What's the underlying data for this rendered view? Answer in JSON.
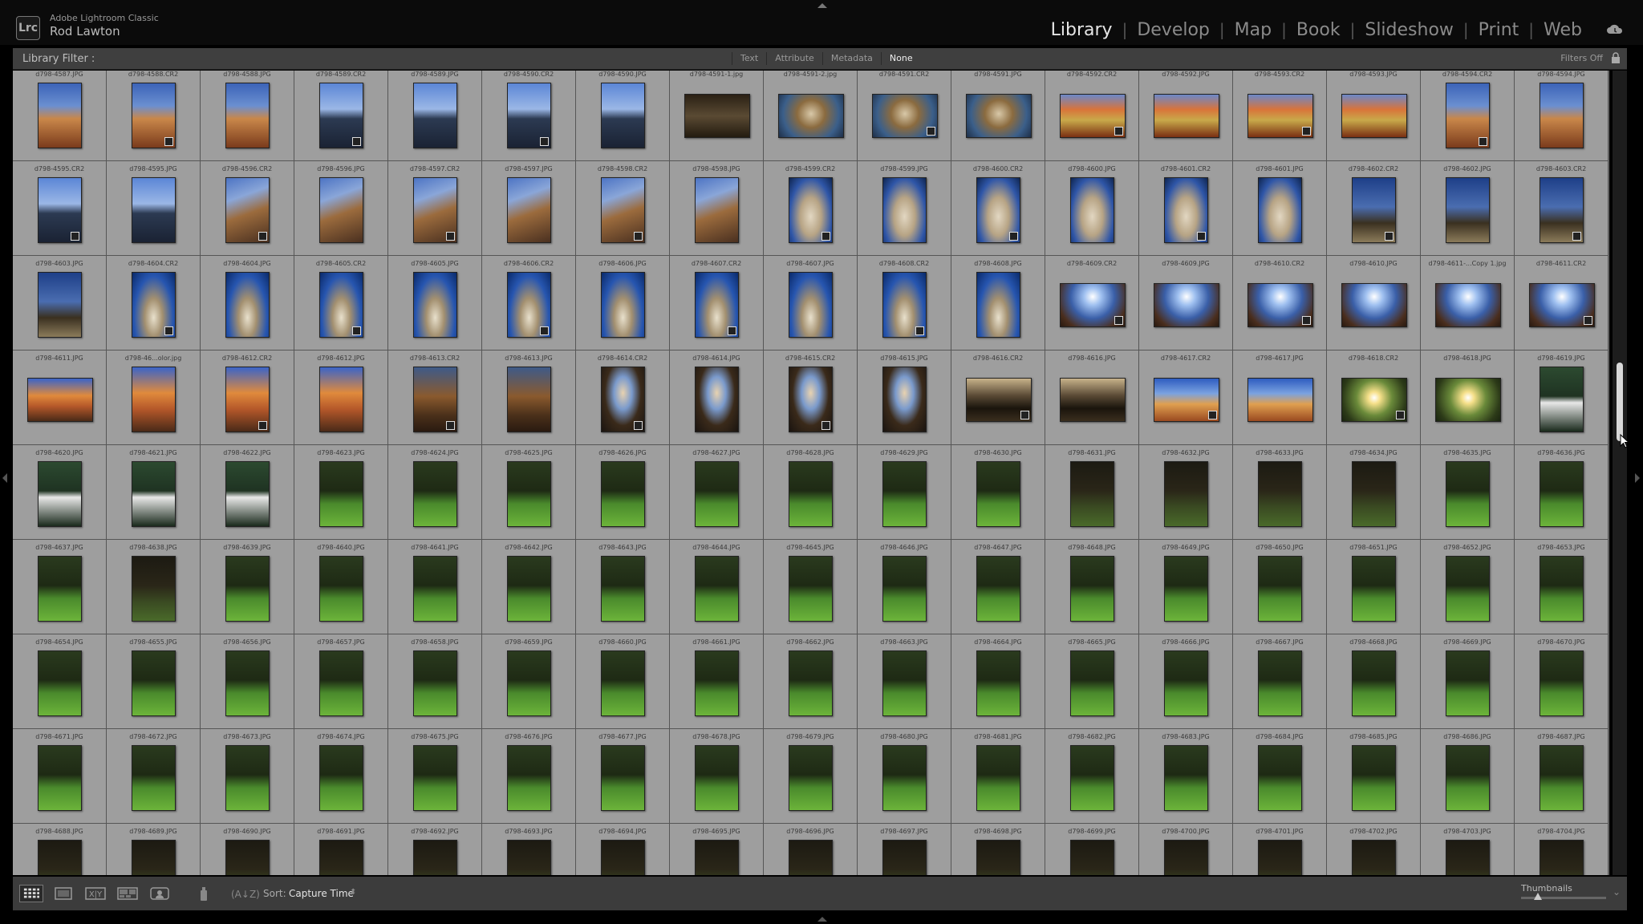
{
  "app": {
    "logo": "Lrc",
    "product": "Adobe Lightroom Classic",
    "identity": "Rod Lawton",
    "modules": [
      "Library",
      "Develop",
      "Map",
      "Book",
      "Slideshow",
      "Print",
      "Web"
    ],
    "active_module": "Library"
  },
  "filter_bar": {
    "label": "Library Filter :",
    "tabs": [
      "Text",
      "Attribute",
      "Metadata",
      "None"
    ],
    "active_tab": "None",
    "status": "Filters Off"
  },
  "toolbar": {
    "sort_label": "Sort:",
    "sort_value": "Capture Time",
    "thumbnails_label": "Thumbnails",
    "thumbnail_size": 0.15
  },
  "colors": {
    "grid_cell": "#9e9e9e",
    "panel": "#3f3f3f",
    "background": "#000000",
    "active_text": "#e6e6e6"
  },
  "grid": {
    "rows": [
      {
        "files": [
          "d798-4587.JPG",
          "d798-4588.CR2",
          "d798-4588.JPG",
          "d798-4589.CR2",
          "d798-4589.JPG",
          "d798-4590.CR2",
          "d798-4590.JPG",
          "d798-4591-1.jpg",
          "d798-4591-2.jpg",
          "d798-4591.CR2",
          "d798-4591.JPG",
          "d798-4592.CR2",
          "d798-4592.JPG",
          "d798-4593.CR2",
          "d798-4593.JPG",
          "d798-4594.CR2",
          "d798-4594.JPG"
        ],
        "orient": [
          "p",
          "p",
          "p",
          "p",
          "p",
          "p",
          "p",
          "l",
          "l",
          "l",
          "l",
          "l",
          "l",
          "l",
          "l",
          "p",
          "p"
        ],
        "scene": [
          "autumn",
          "autumn",
          "autumn",
          "pond",
          "pond",
          "pond",
          "pond",
          "dark",
          "fisheye",
          "fisheye",
          "fisheye",
          "leaves",
          "leaves",
          "leaves",
          "leaves",
          "autumn",
          "autumn"
        ]
      },
      {
        "files": [
          "d798-4595.CR2",
          "d798-4595.JPG",
          "d798-4596.CR2",
          "d798-4596.JPG",
          "d798-4597.CR2",
          "d798-4597.JPG",
          "d798-4598.CR2",
          "d798-4598.JPG",
          "d798-4599.CR2",
          "d798-4599.JPG",
          "d798-4600.CR2",
          "d798-4600.JPG",
          "d798-4601.CR2",
          "d798-4601.JPG",
          "d798-4602.CR2",
          "d798-4602.JPG",
          "d798-4603.CR2"
        ],
        "orient": [
          "p",
          "p",
          "p",
          "p",
          "p",
          "p",
          "p",
          "p",
          "p",
          "p",
          "p",
          "p",
          "p",
          "p",
          "p",
          "p",
          "p"
        ],
        "scene": [
          "pond",
          "pond",
          "branch",
          "branch",
          "branch",
          "branch",
          "branch",
          "branch",
          "trunk",
          "trunk",
          "trunk",
          "trunk",
          "trunk",
          "trunk",
          "tree",
          "tree",
          "tree"
        ]
      },
      {
        "files": [
          "d798-4603.JPG",
          "d798-4604.CR2",
          "d798-4604.JPG",
          "d798-4605.CR2",
          "d798-4605.JPG",
          "d798-4606.CR2",
          "d798-4606.JPG",
          "d798-4607.CR2",
          "d798-4607.JPG",
          "d798-4608.CR2",
          "d798-4608.JPG",
          "d798-4609.CR2",
          "d798-4609.JPG",
          "d798-4610.CR2",
          "d798-4610.JPG",
          "d798-4611-...Copy 1.jpg",
          "d798-4611.CR2"
        ],
        "orient": [
          "p",
          "p",
          "p",
          "p",
          "p",
          "p",
          "p",
          "p",
          "p",
          "p",
          "p",
          "l",
          "l",
          "l",
          "l",
          "l",
          "l"
        ],
        "scene": [
          "tree",
          "sky",
          "sky",
          "sky",
          "sky",
          "sky",
          "sky",
          "sky",
          "sky",
          "sky",
          "sky",
          "sun",
          "sun",
          "sun",
          "sun",
          "sun",
          "sun"
        ]
      },
      {
        "files": [
          "d798-4611.JPG",
          "d798-46...olor.jpg",
          "d798-4612.CR2",
          "d798-4612.JPG",
          "d798-4613.CR2",
          "d798-4613.JPG",
          "d798-4614.CR2",
          "d798-4614.JPG",
          "d798-4615.CR2",
          "d798-4615.JPG",
          "d798-4616.CR2",
          "d798-4616.JPG",
          "d798-4617.CR2",
          "d798-4617.JPG",
          "d798-4618.CR2",
          "d798-4618.JPG",
          "d798-4619.JPG"
        ],
        "orient": [
          "l",
          "p",
          "p",
          "p",
          "p",
          "p",
          "p",
          "p",
          "p",
          "p",
          "l",
          "l",
          "l",
          "l",
          "l",
          "l",
          "p"
        ],
        "scene": [
          "bigtree",
          "bigtree",
          "bigtree",
          "bigtree",
          "rusty",
          "rusty",
          "shadow",
          "shadow",
          "shadow",
          "shadow",
          "silhouette",
          "silhouette",
          "autumnsky",
          "autumnsky",
          "sunflare",
          "sunflare",
          "person"
        ]
      },
      {
        "files": [
          "d798-4620.JPG",
          "d798-4621.JPG",
          "d798-4622.JPG",
          "d798-4623.JPG",
          "d798-4624.JPG",
          "d798-4625.JPG",
          "d798-4626.JPG",
          "d798-4627.JPG",
          "d798-4628.JPG",
          "d798-4629.JPG",
          "d798-4630.JPG",
          "d798-4631.JPG",
          "d798-4632.JPG",
          "d798-4633.JPG",
          "d798-4634.JPG",
          "d798-4635.JPG",
          "d798-4636.JPG"
        ],
        "orient": [
          "p",
          "p",
          "p",
          "p",
          "p",
          "p",
          "p",
          "p",
          "p",
          "p",
          "p",
          "p",
          "p",
          "p",
          "p",
          "p",
          "p"
        ],
        "scene": [
          "person",
          "person",
          "person",
          "lawn",
          "lawn",
          "lawn",
          "lawn",
          "lawn",
          "lawn",
          "lawn",
          "lawn",
          "dim",
          "dim",
          "dim",
          "dim",
          "lawn",
          "lawn"
        ]
      },
      {
        "files": [
          "d798-4637.JPG",
          "d798-4638.JPG",
          "d798-4639.JPG",
          "d798-4640.JPG",
          "d798-4641.JPG",
          "d798-4642.JPG",
          "d798-4643.JPG",
          "d798-4644.JPG",
          "d798-4645.JPG",
          "d798-4646.JPG",
          "d798-4647.JPG",
          "d798-4648.JPG",
          "d798-4649.JPG",
          "d798-4650.JPG",
          "d798-4651.JPG",
          "d798-4652.JPG",
          "d798-4653.JPG"
        ],
        "orient": [
          "p",
          "p",
          "p",
          "p",
          "p",
          "p",
          "p",
          "p",
          "p",
          "p",
          "p",
          "p",
          "p",
          "p",
          "p",
          "p",
          "p"
        ],
        "scene": [
          "lawn",
          "dim",
          "lawn",
          "lawn",
          "lawn",
          "lawn",
          "lawn",
          "lawn",
          "lawn",
          "lawn",
          "lawn",
          "lawn",
          "lawn",
          "lawn",
          "lawn",
          "lawn",
          "lawn"
        ]
      },
      {
        "files": [
          "d798-4654.JPG",
          "d798-4655.JPG",
          "d798-4656.JPG",
          "d798-4657.JPG",
          "d798-4658.JPG",
          "d798-4659.JPG",
          "d798-4660.JPG",
          "d798-4661.JPG",
          "d798-4662.JPG",
          "d798-4663.JPG",
          "d798-4664.JPG",
          "d798-4665.JPG",
          "d798-4666.JPG",
          "d798-4667.JPG",
          "d798-4668.JPG",
          "d798-4669.JPG",
          "d798-4670.JPG"
        ],
        "orient": [
          "p",
          "p",
          "p",
          "p",
          "p",
          "p",
          "p",
          "p",
          "p",
          "p",
          "p",
          "p",
          "p",
          "p",
          "p",
          "p",
          "p"
        ],
        "scene": [
          "lawn",
          "lawn",
          "lawn",
          "lawn",
          "lawn",
          "lawn",
          "lawn",
          "lawn",
          "lawn",
          "lawn",
          "lawn",
          "lawn",
          "lawn",
          "lawn",
          "lawn",
          "lawn",
          "lawn"
        ]
      },
      {
        "files": [
          "d798-4671.JPG",
          "d798-4672.JPG",
          "d798-4673.JPG",
          "d798-4674.JPG",
          "d798-4675.JPG",
          "d798-4676.JPG",
          "d798-4677.JPG",
          "d798-4678.JPG",
          "d798-4679.JPG",
          "d798-4680.JPG",
          "d798-4681.JPG",
          "d798-4682.JPG",
          "d798-4683.JPG",
          "d798-4684.JPG",
          "d798-4685.JPG",
          "d798-4686.JPG",
          "d798-4687.JPG"
        ],
        "orient": [
          "p",
          "p",
          "p",
          "p",
          "p",
          "p",
          "p",
          "p",
          "p",
          "p",
          "p",
          "p",
          "p",
          "p",
          "p",
          "p",
          "p"
        ],
        "scene": [
          "lawn",
          "lawn",
          "lawn",
          "lawn",
          "lawn",
          "lawn",
          "lawn",
          "lawn",
          "lawn",
          "lawn",
          "lawn",
          "lawn",
          "lawn",
          "lawn",
          "lawn",
          "lawn",
          "lawn"
        ]
      },
      {
        "files": [
          "d798-4688.JPG",
          "d798-4689.JPG",
          "d798-4690.JPG",
          "d798-4691.JPG",
          "d798-4692.JPG",
          "d798-4693.JPG",
          "d798-4694.JPG",
          "d798-4695.JPG",
          "d798-4696.JPG",
          "d798-4697.JPG",
          "d798-4698.JPG",
          "d798-4699.JPG",
          "d798-4700.JPG",
          "d798-4701.JPG",
          "d798-4702.JPG",
          "d798-4703.JPG",
          "d798-4704.JPG"
        ],
        "orient": [
          "p",
          "p",
          "p",
          "p",
          "p",
          "p",
          "p",
          "p",
          "p",
          "p",
          "p",
          "p",
          "p",
          "p",
          "p",
          "p",
          "p"
        ],
        "scene": [
          "dim",
          "dim",
          "dim",
          "dim",
          "dim",
          "dim",
          "dim",
          "dim",
          "dim",
          "dim",
          "dim",
          "dim",
          "dim",
          "dim",
          "dim",
          "dim",
          "dim"
        ]
      }
    ]
  }
}
